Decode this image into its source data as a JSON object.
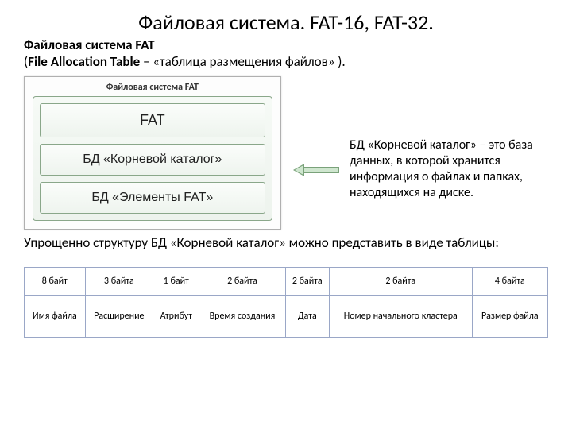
{
  "title": "Файловая система. FAT-16, FAT-32.",
  "subtitle_bold": "Файловая система FAT",
  "subtitle_rest_prefix": "(",
  "subtitle_rest_bold": "File Allocation Table",
  "subtitle_rest_suffix": " – «таблица размещения файлов» ).",
  "diagram": {
    "caption": "Файловая система FAT",
    "boxes": [
      "FAT",
      "БД «Корневой каталог»",
      "БД «Элементы FAT»"
    ]
  },
  "note": "БД «Корневой каталог» – это база данных, в которой хранится информация о файлах и папках, находящихся на диске.",
  "para": "Упрощенно структуру БД «Корневой каталог» можно представить в виде таблицы:",
  "table": {
    "sizes": [
      "8 байт",
      "3 байта",
      "1 байт",
      "2 байта",
      "2 байта",
      "2 байта",
      "4 байта"
    ],
    "labels": [
      "Имя файла",
      "Расширение",
      "Атрибут",
      "Время создания",
      "Дата",
      "Номер начального кластера",
      "Размер файла"
    ]
  }
}
